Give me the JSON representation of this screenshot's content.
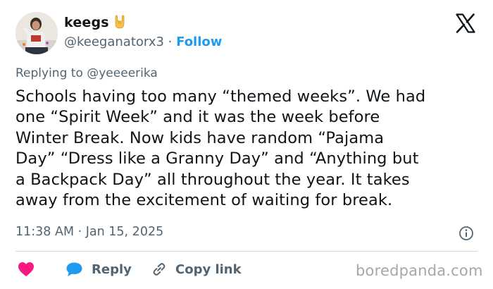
{
  "author": {
    "display_name": "keegs",
    "name_emoji": "rock-on-hand-emoji",
    "handle": "@keeganatorx3",
    "separator": "·",
    "follow_label": "Follow"
  },
  "reply_context": {
    "prefix": "Replying to",
    "mention": "@yeeeerika"
  },
  "tweet": {
    "lines": [
      "Schools having too many “themed weeks”. We had",
      "one “Spirit Week” and it was the week before",
      "Winter Break. Now kids have random “Pajama",
      "Day” “Dress like a Granny Day” and “Anything but",
      "a Backpack Day” all throughout the year. It takes",
      "away from the excitement of waiting for break."
    ],
    "timestamp": "11:38 AM · Jan 15, 2025"
  },
  "actions": {
    "like_icon": "heart-icon",
    "reply_label": "Reply",
    "reply_icon": "speech-bubble-icon",
    "copy_label": "Copy link",
    "copy_icon": "link-icon"
  },
  "icons": {
    "brand": "x-logo-icon",
    "info": "info-icon"
  },
  "watermark": "boredpanda.com",
  "colors": {
    "text": "#0f1419",
    "muted": "#536471",
    "accent": "#1d9bf0",
    "like": "#f91880",
    "divider": "#cfd9de"
  }
}
